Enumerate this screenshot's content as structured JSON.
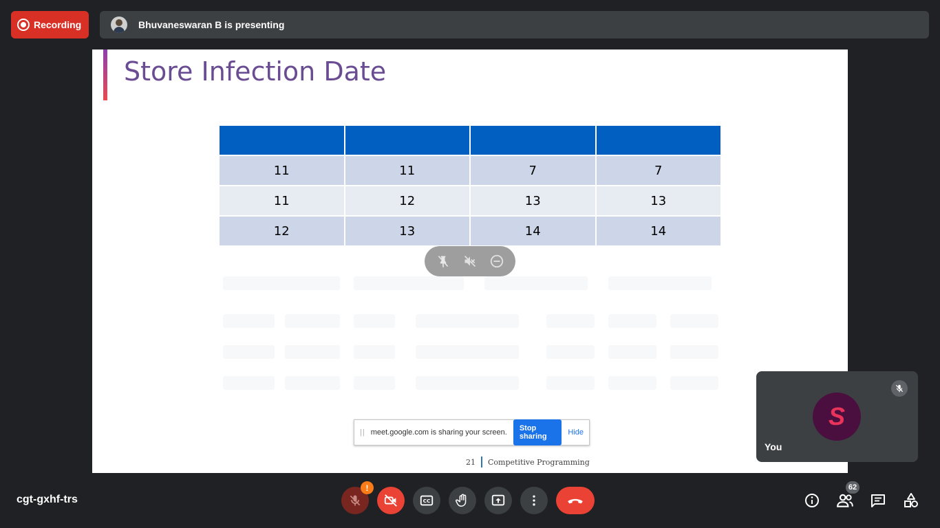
{
  "recording": {
    "label": "Recording"
  },
  "presenter": {
    "text": "Bhuvaneswaran B is presenting"
  },
  "slide": {
    "title": "Store Infection Date",
    "table": {
      "rows": [
        [
          "11",
          "11",
          "7",
          "7"
        ],
        [
          "11",
          "12",
          "13",
          "13"
        ],
        [
          "12",
          "13",
          "14",
          "14"
        ]
      ]
    },
    "footer": {
      "page": "21",
      "course": "Competitive Programming"
    }
  },
  "share_bar": {
    "text": "meet.google.com is sharing your screen.",
    "stop_label": "Stop sharing",
    "hide_label": "Hide"
  },
  "self_tile": {
    "initial": "S",
    "name": "You"
  },
  "meeting": {
    "code": "cgt-gxhf-trs"
  },
  "badges": {
    "mic_warning": "!",
    "people_count": "62"
  },
  "colors": {
    "accent_red": "#d93025",
    "bar_bg": "#3c4043",
    "table_header": "#005fc1",
    "title": "#6a4c93"
  }
}
